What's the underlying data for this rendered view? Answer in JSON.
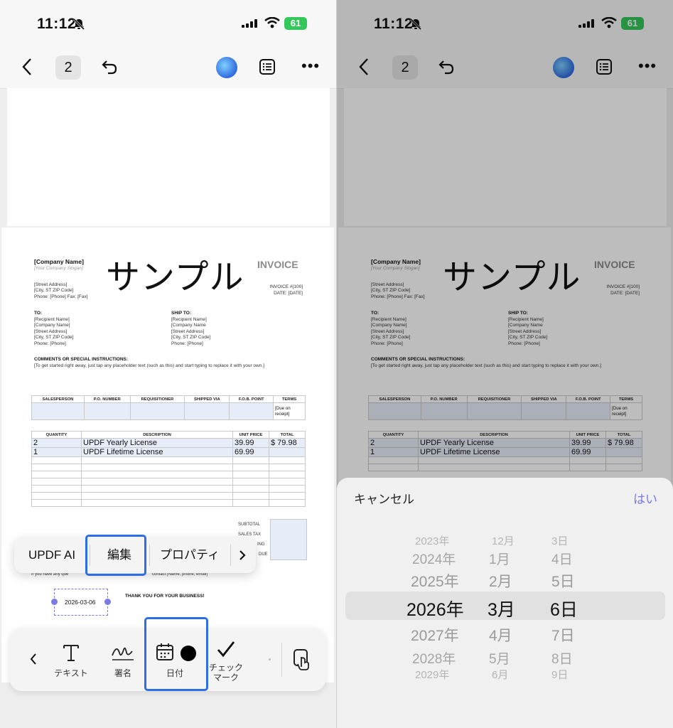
{
  "status": {
    "time": "11:12",
    "battery": "61"
  },
  "toolbar": {
    "page": "2"
  },
  "doc": {
    "company_name": "[Company Name]",
    "slogan": "[Your Company Slogan]",
    "sample": "サンプル",
    "invoice_title": "INVOICE",
    "address_lines": [
      "[Street Address]",
      "[City, ST ZIP Code]",
      "Phone: [Phone]  Fax: [Fax]"
    ],
    "invoice_no": "INVOICE #[100]",
    "invoice_date": "DATE: [DATE]",
    "to_label": "TO:",
    "to_lines": [
      "[Recipient Name]",
      "[Company Name]",
      "[Street Address]",
      "[City, ST ZIP Code]",
      "Phone: [Phone]"
    ],
    "ship_label": "SHIP TO:",
    "ship_lines": [
      "[Recipient Name]",
      "[Company Name",
      "[Street Address]",
      "[City, ST ZIP Code]",
      "Phone: [Phone]"
    ],
    "comments_label": "COMMENTS OR SPECIAL INSTRUCTIONS:",
    "comments_text": "[To get started right away, just tap any placeholder text (such as this) and start typing to replace it with your own.]",
    "sales_headers": [
      "SALESPERSON",
      "P.O. NUMBER",
      "REQUISITIONER",
      "SHIPPED VIA",
      "F.O.B. POINT",
      "TERMS"
    ],
    "terms_value": "[Due on receipt]",
    "item_headers": [
      "QUANTITY",
      "DESCRIPTION",
      "UNIT PRICE",
      "TOTAL"
    ],
    "items": [
      {
        "qty": "2",
        "desc": "UPDF Yearly License",
        "price": "39.99",
        "total": "$ 79.98"
      },
      {
        "qty": "1",
        "desc": "UPDF Lifetime License",
        "price": "69.99",
        "total": ""
      }
    ],
    "subtotal_label": "SUBTOTAL",
    "salestax_label": "SALES TAX",
    "shipping_label_partial": "ING",
    "due_label_partial": "DUE",
    "footer_partial_a": "If you have any que",
    "footer_partial_b": "contact [Name, phone, email]",
    "thanks": "THANK YOU FOR YOUR BUSINESS!",
    "date_value": "2026-03-06"
  },
  "context_menu": {
    "ai": "UPDF AI",
    "edit": "編集",
    "props": "プロパティ"
  },
  "tools": {
    "text": "テキスト",
    "sign": "署名",
    "date": "日付",
    "check_line1": "チェック",
    "check_line2": "マーク"
  },
  "picker": {
    "cancel": "キャンセル",
    "ok": "はい",
    "years": [
      "2023年",
      "2024年",
      "2025年",
      "2026年",
      "2027年",
      "2028年",
      "2029年"
    ],
    "months": [
      "12月",
      "1月",
      "2月",
      "3月",
      "4月",
      "5月",
      "6月"
    ],
    "days": [
      "3日",
      "4日",
      "5日",
      "6日",
      "7日",
      "8日",
      "9日"
    ]
  },
  "colors": {
    "accent_blue": "#2d6ee8",
    "picker_ok": "#7b78e8",
    "battery": "#34c759",
    "handle": "#7a7ae6"
  }
}
